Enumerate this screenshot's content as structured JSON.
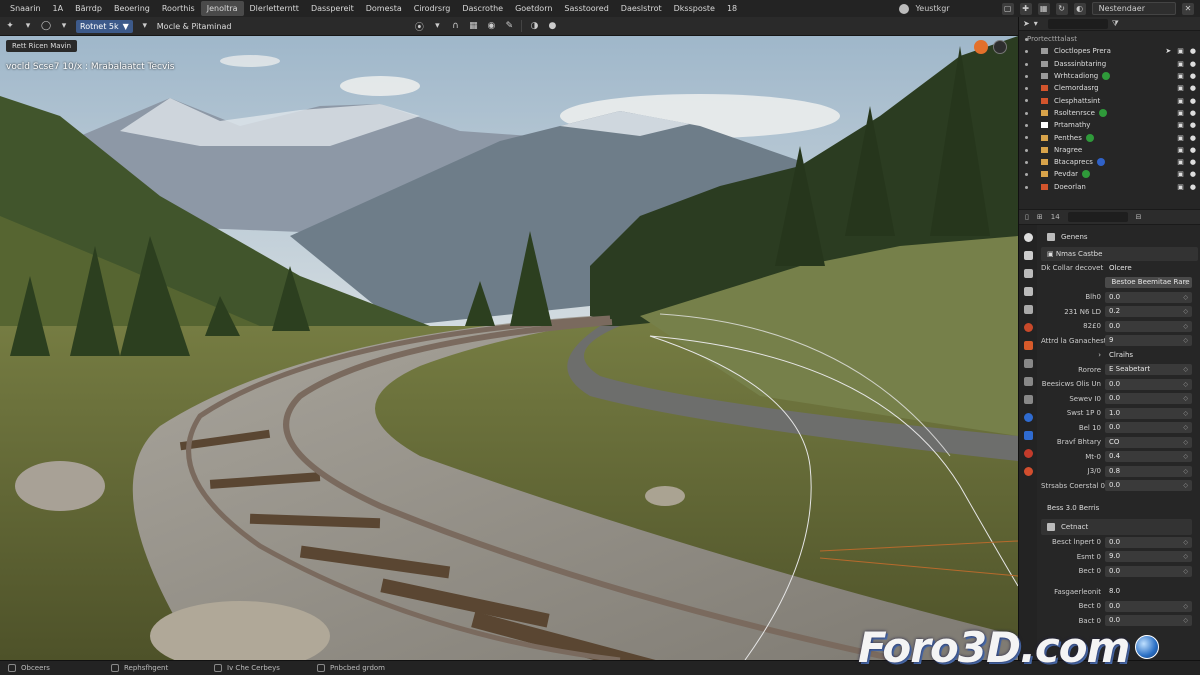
{
  "menubar": {
    "items": [
      "Snaarin",
      "1A",
      "Bärrdp",
      "Beoering",
      "Roorthis",
      "Jenoltra",
      "Dlerletterntt",
      "Dasspereit",
      "Domesta",
      "Cirodrsrg",
      "Dascrothe",
      "Goetdorn",
      "Sasstoored",
      "Daeslstrot",
      "Dkssposte",
      "18"
    ],
    "active_index": 5,
    "workspace_label": "Yeustkgr",
    "scene_label": "Nestendaer"
  },
  "toolbar": {
    "mode_label": "Rotnet 5k",
    "viewport_title": "Mocle & Pitaminad"
  },
  "viewport": {
    "overlay_button": "Rett Ricen Mavin",
    "info_text": "vocld Scse7 10/x : Mrabalaatct Tecvis"
  },
  "outliner": {
    "header": "Prortectttalast",
    "rows": [
      {
        "label": "Cloctlopes Prera",
        "color": "#9a9a9a",
        "badge": ""
      },
      {
        "label": "Dasssinbtaring",
        "color": "#9a9a9a",
        "badge": ""
      },
      {
        "label": "Wrhtcadiong",
        "color": "#9a9a9a",
        "badge": "#2f9a3a"
      },
      {
        "label": "Clemordasrg",
        "color": "#d2542c",
        "badge": ""
      },
      {
        "label": "Clesphattsint",
        "color": "#d2542c",
        "badge": ""
      },
      {
        "label": "Rsoltenrsce",
        "color": "#d8a34a",
        "badge": "#2f9a3a"
      },
      {
        "label": "Prtamathy",
        "color": "#ffffff",
        "badge": ""
      },
      {
        "label": "Penthes",
        "color": "#d8a34a",
        "badge": "#2f9a3a"
      },
      {
        "label": "Nragree",
        "color": "#d8a34a",
        "badge": ""
      },
      {
        "label": "Btacaprecs",
        "color": "#d8a34a",
        "badge": "#3062c8"
      },
      {
        "label": "Pevdar",
        "color": "#d8a34a",
        "badge": "#2f9a3a"
      },
      {
        "label": "Doeorlan",
        "color": "#d2542c",
        "badge": ""
      }
    ]
  },
  "properties": {
    "tab_number": "14",
    "section_title": "Genens",
    "subsection": "Nmas Castbe",
    "subpanel_label": "Dk Collar decovet",
    "subpanel_value": "Olcere",
    "highlight_field": "Bestoe Beemitae Rare",
    "rows_a": [
      {
        "label": "Blh0",
        "value": "0.0"
      },
      {
        "label": "231 N6 LD",
        "value": "0.2"
      },
      {
        "label": "82£0",
        "value": "0.0"
      },
      {
        "label": "Attrd la Ganachests",
        "value": "9"
      }
    ],
    "toggle_label": "Clraihs",
    "row_rotate": {
      "label": "Rorore",
      "value": "E Seabetart"
    },
    "rows_b": [
      {
        "label": "Beesicws Olis Un",
        "value": "0.0"
      },
      {
        "label": "Sewev I0",
        "value": "0.0"
      },
      {
        "label": "Swst 1P 0",
        "value": "1.0"
      },
      {
        "label": "Bel 10",
        "value": "0.0"
      }
    ],
    "rows_c": [
      {
        "label": "Bravf Bhtary",
        "value": "CO"
      },
      {
        "label": "Mt-0",
        "value": "0.4"
      },
      {
        "label": "J3/0",
        "value": "0.8"
      },
      {
        "label": "Strsabs Coerstal 0",
        "value": "0.0"
      }
    ],
    "group_title": "Bess 3.0 Berris",
    "group2_title": "Cetnact",
    "rows_d": [
      {
        "label": "Besct lnpert 0",
        "value": "0.0"
      },
      {
        "label": "Esmt 0",
        "value": "9.0"
      },
      {
        "label": "Bect 0",
        "value": "0.0"
      }
    ],
    "rows_e": [
      {
        "label": "Fasgaerleonit",
        "value": "8.0"
      },
      {
        "label": "Bect 0",
        "value": "0.0"
      },
      {
        "label": "Bact 0",
        "value": "0.0"
      }
    ]
  },
  "statusbar": {
    "items": [
      "Obceers",
      "Rephsfhgent",
      "Iv Che Cerbeys",
      "Pnbcbed grdom"
    ]
  },
  "watermark": "Foro3D.com",
  "colors": {
    "accent": "#3d5a8a",
    "panel": "#262626",
    "header": "#232323"
  }
}
